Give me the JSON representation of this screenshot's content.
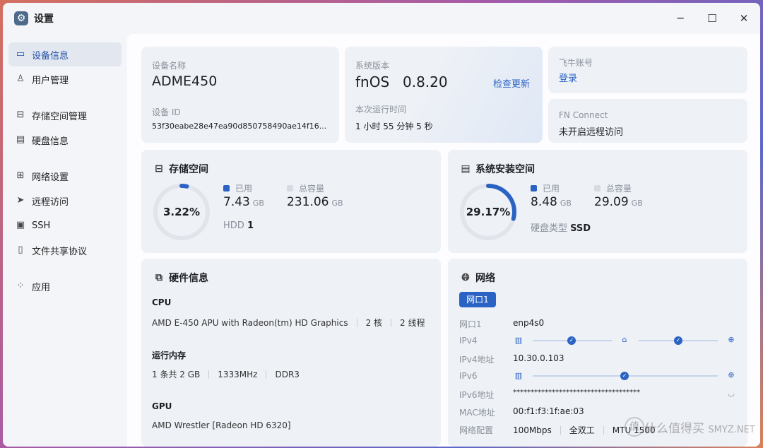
{
  "window": {
    "title": "设置",
    "minimize_icon": "minimize-icon",
    "maximize_icon": "maximize-icon",
    "close_icon": "close-icon"
  },
  "sidebar": {
    "items": [
      {
        "label": "设备信息",
        "icon": "device-icon",
        "active": true
      },
      {
        "label": "用户管理",
        "icon": "user-icon"
      },
      {
        "label": "存储空间管理",
        "icon": "storage-icon"
      },
      {
        "label": "硬盘信息",
        "icon": "disk-icon"
      },
      {
        "label": "网络设置",
        "icon": "network-icon"
      },
      {
        "label": "远程访问",
        "icon": "remote-icon"
      },
      {
        "label": "SSH",
        "icon": "terminal-icon"
      },
      {
        "label": "文件共享协议",
        "icon": "file-share-icon"
      },
      {
        "label": "应用",
        "icon": "apps-icon"
      }
    ]
  },
  "device": {
    "name_label": "设备名称",
    "name": "ADME450",
    "id_label": "设备 ID",
    "id": "53f30eabe28e47ea90d850758490ae14f16..."
  },
  "system": {
    "version_label": "系统版本",
    "os": "fnOS",
    "version": "0.8.20",
    "check_update": "检查更新",
    "uptime_label": "本次运行时间",
    "uptime": "1 小时 55 分钟 5 秒"
  },
  "account": {
    "label": "飞牛账号",
    "login": "登录"
  },
  "fnconnect": {
    "label": "FN Connect",
    "status": "未开启远程访问"
  },
  "storage": {
    "title": "存储空间",
    "percent": "3.22%",
    "fraction": 0.0322,
    "used_label": "已用",
    "used": "7.43",
    "used_unit": "GB",
    "total_label": "总容量",
    "total": "231.06",
    "total_unit": "GB",
    "disk_type": "HDD",
    "disk_count": "1"
  },
  "sysdisk": {
    "title": "系统安装空间",
    "percent": "29.17%",
    "fraction": 0.2917,
    "used_label": "已用",
    "used": "8.48",
    "used_unit": "GB",
    "total_label": "总容量",
    "total": "29.09",
    "total_unit": "GB",
    "type_label": "硬盘类型",
    "type": "SSD"
  },
  "hardware": {
    "title": "硬件信息",
    "cpu_label": "CPU",
    "cpu_model": "AMD E-450 APU with Radeon(tm) HD Graphics",
    "cpu_cores": "2 核",
    "cpu_threads": "2 线程",
    "ram_label": "运行内存",
    "ram_modules": "1 条共 2 GB",
    "ram_speed": "1333MHz",
    "ram_type": "DDR3",
    "gpu_label": "GPU",
    "gpu_model": "AMD Wrestler [Radeon HD 6320]"
  },
  "network": {
    "title": "网络",
    "tab": "网口1",
    "port_label": "网口1",
    "port": "enp4s0",
    "ipv4_label": "IPv4",
    "ipv4_addr_label": "IPv4地址",
    "ipv4_addr": "10.30.0.103",
    "ipv6_label": "IPv6",
    "ipv6_addr_label": "IPv6地址",
    "ipv6_addr": "************************************",
    "mac_label": "MAC地址",
    "mac": "00:f1:f3:1f:ae:03",
    "config_label": "网络配置",
    "speed": "100Mbps",
    "duplex": "全双工",
    "mtu": "MTU 1500"
  },
  "watermark": {
    "text": "什么值得买",
    "site": "SMYZ.NET"
  },
  "colors": {
    "accent": "#2b63c4",
    "ring_bg": "#e1e4ea"
  }
}
